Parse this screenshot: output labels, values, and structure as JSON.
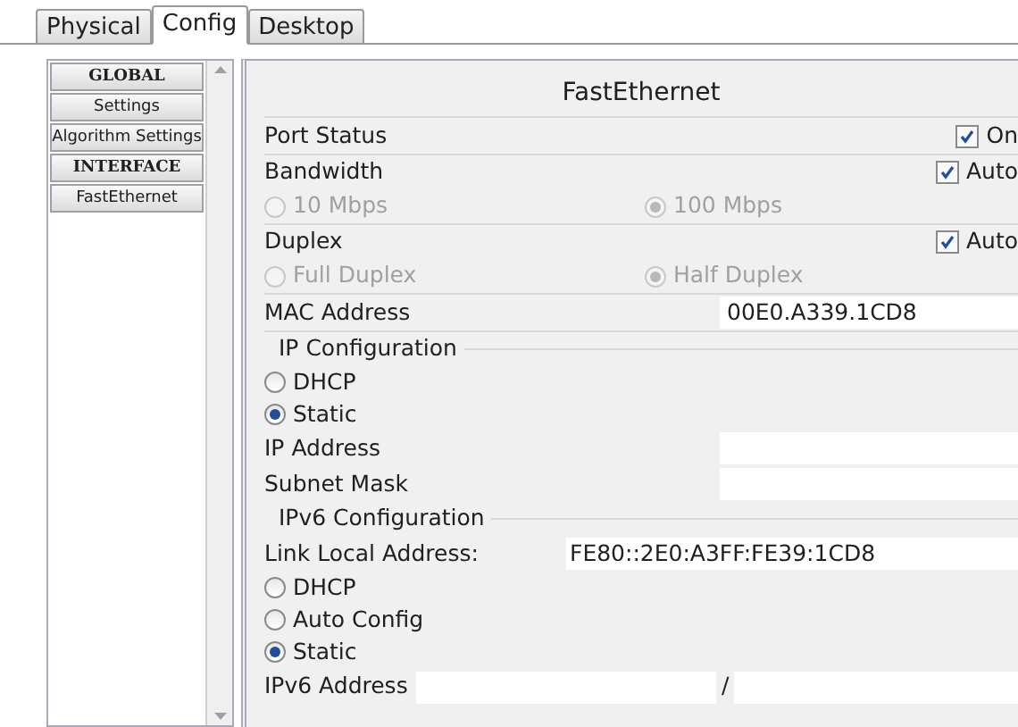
{
  "tabs": [
    {
      "label": "Physical",
      "selected": false
    },
    {
      "label": "Config",
      "selected": true
    },
    {
      "label": "Desktop",
      "selected": false
    }
  ],
  "sidebar": {
    "items": [
      {
        "label": "GLOBAL",
        "kind": "header"
      },
      {
        "label": "Settings",
        "kind": "item"
      },
      {
        "label": "Algorithm Settings",
        "kind": "item"
      },
      {
        "label": "INTERFACE",
        "kind": "header"
      },
      {
        "label": "FastEthernet",
        "kind": "item"
      }
    ]
  },
  "panel": {
    "title": "FastEthernet",
    "port_status": {
      "label": "Port Status",
      "checkbox": {
        "label": "On",
        "checked": true
      }
    },
    "bandwidth": {
      "label": "Bandwidth",
      "auto": {
        "label": "Auto",
        "checked": true
      },
      "options": [
        {
          "label": "10 Mbps",
          "selected": false,
          "disabled": true
        },
        {
          "label": "100 Mbps",
          "selected": true,
          "disabled": true
        }
      ]
    },
    "duplex": {
      "label": "Duplex",
      "auto": {
        "label": "Auto",
        "checked": true
      },
      "options": [
        {
          "label": "Full Duplex",
          "selected": false,
          "disabled": true
        },
        {
          "label": "Half Duplex",
          "selected": true,
          "disabled": true
        }
      ]
    },
    "mac_address": {
      "label": "MAC Address",
      "value": "00E0.A339.1CD8"
    },
    "ip_configuration": {
      "legend": "IP Configuration",
      "modes": [
        {
          "label": "DHCP",
          "selected": false
        },
        {
          "label": "Static",
          "selected": true
        }
      ],
      "fields": [
        {
          "label": "IP Address"
        },
        {
          "label": "Subnet Mask"
        }
      ]
    },
    "ipv6_configuration": {
      "legend": "IPv6 Configuration",
      "link_local": {
        "label": "Link Local Address:",
        "value": "FE80::2E0:A3FF:FE39:1CD8"
      },
      "modes": [
        {
          "label": "DHCP",
          "selected": false
        },
        {
          "label": "Auto Config",
          "selected": false
        },
        {
          "label": "Static",
          "selected": true
        }
      ],
      "address": {
        "label": "IPv6 Address",
        "separator": "/"
      }
    }
  }
}
